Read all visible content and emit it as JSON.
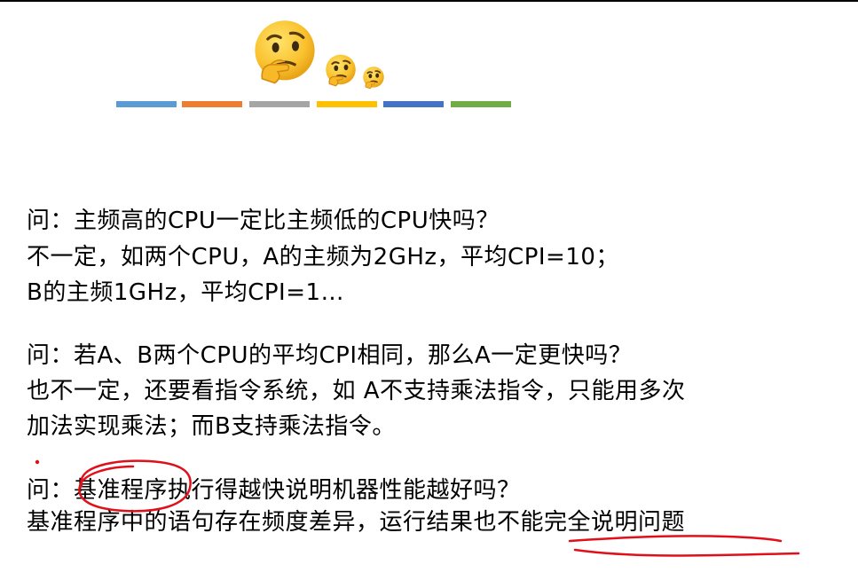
{
  "decor": {
    "emoji_names": [
      "thinking-face-large",
      "thinking-face-medium",
      "thinking-face-small"
    ],
    "bar_colors": [
      "#5b9bd5",
      "#ed7d31",
      "#a5a5a5",
      "#ffc000",
      "#4472c4",
      "#70ad47"
    ],
    "ink_color": "#e0101a"
  },
  "content": {
    "q1": "问：主频高的CPU一定比主频低的CPU快吗？",
    "a1_line1": "不一定，如两个CPU，A的主频为2GHz，平均CPI=10；",
    "a1_line2": "B的主频1GHz，平均CPI=1…",
    "q2": "问：若A、B两个CPU的平均CPI相同，那么A一定更快吗？",
    "a2_line1": "也不一定，还要看指令系统，如 A不支持乘法指令，只能用多次",
    "a2_line2": "加法实现乘法；而B支持乘法指令。",
    "q3": "问：基准程序执行得越快说明机器性能越好吗？",
    "a3": "基准程序中的语句存在频度差异，运行结果也不能完全说明问题"
  }
}
